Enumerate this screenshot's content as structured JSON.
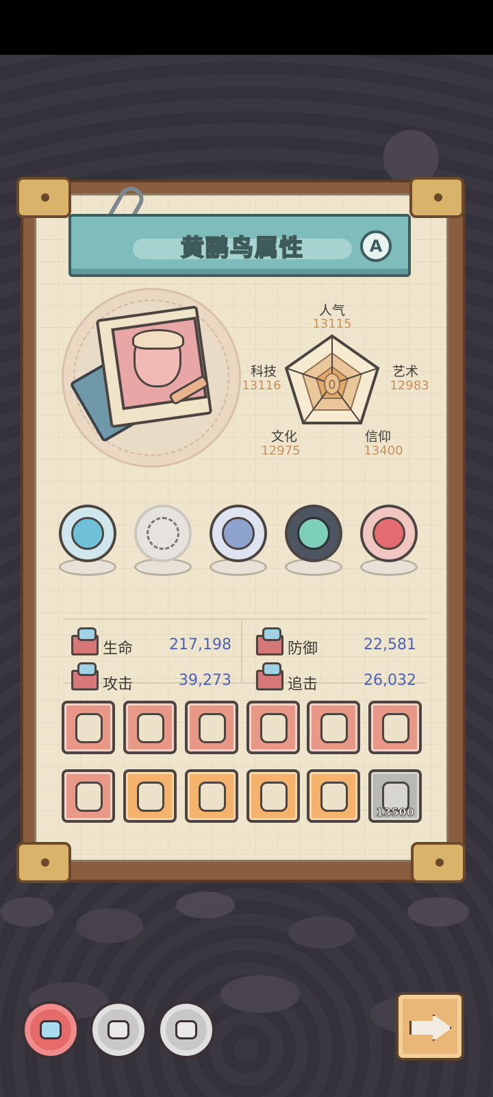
{
  "panel": {
    "title": "黄鹂鸟属性",
    "grade": "A"
  },
  "radar": {
    "center_value": "0",
    "stats": [
      {
        "name": "人气",
        "value": "13115"
      },
      {
        "name": "艺术",
        "value": "12983"
      },
      {
        "name": "信仰",
        "value": "13400"
      },
      {
        "name": "文化",
        "value": "12975"
      },
      {
        "name": "科技",
        "value": "13116"
      }
    ]
  },
  "relics": [
    {
      "icon": "sea-serpent-orb-icon",
      "color": "#6fc1d9"
    },
    {
      "icon": "empty-wing-orb-icon",
      "color": "#e6e3de"
    },
    {
      "icon": "compass-orb-icon",
      "color": "#8ea4cf"
    },
    {
      "icon": "jade-ring-orb-icon",
      "color": "#7dcfb8"
    },
    {
      "icon": "lava-orb-icon",
      "color": "#e46c70"
    }
  ],
  "attributes": {
    "hp": {
      "label": "生命",
      "value": "217,198"
    },
    "defense": {
      "label": "防御",
      "value": "22,581"
    },
    "attack": {
      "label": "攻击",
      "value": "39,273"
    },
    "chase": {
      "label": "追击",
      "value": "26,032"
    }
  },
  "equipment": [
    {
      "icon": "skull-scepter-icon",
      "rarity": "red"
    },
    {
      "icon": "lantern-hammer-icon",
      "rarity": "red"
    },
    {
      "icon": "scale-icon",
      "rarity": "red"
    },
    {
      "icon": "dragon-skull-icon",
      "rarity": "red"
    },
    {
      "icon": "crystal-claw-icon",
      "rarity": "red"
    },
    {
      "icon": "patterned-robe-icon",
      "rarity": "red"
    },
    {
      "icon": "jeweled-crown-icon",
      "rarity": "red"
    },
    {
      "icon": "crossed-swords-icon",
      "rarity": "orange"
    },
    {
      "icon": "dagger-icon",
      "rarity": "orange"
    },
    {
      "icon": "armor-icon",
      "rarity": "orange"
    },
    {
      "icon": "gem-ring-icon",
      "rarity": "orange"
    },
    {
      "icon": "fish-bone-icon",
      "rarity": "gray",
      "count": "13500"
    }
  ],
  "bottom_nav": {
    "next_label": ""
  }
}
